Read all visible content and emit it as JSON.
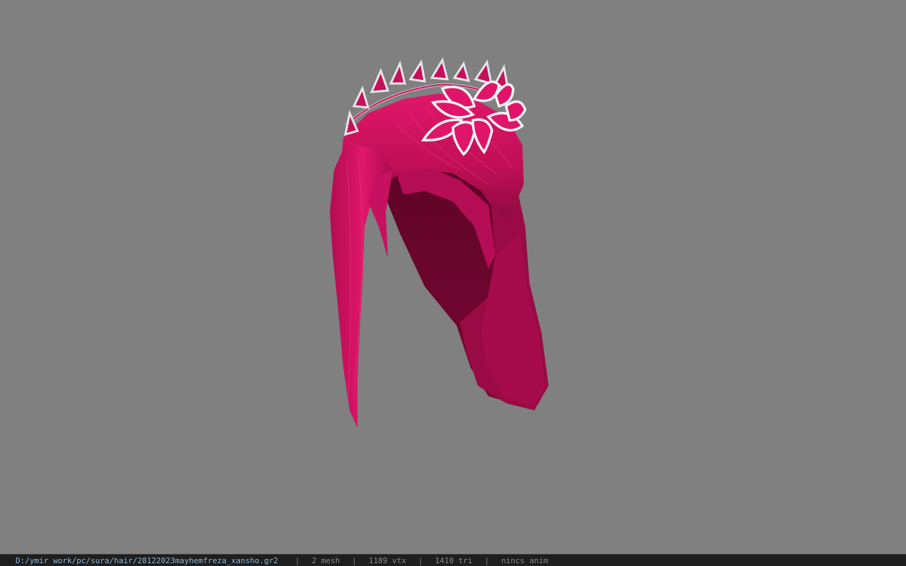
{
  "viewer": {
    "background": "#808080",
    "model": {
      "icon": "hair-with-leaf-tiara-model",
      "hair_color": "#d0115e",
      "accent_color": "#ffffff"
    }
  },
  "status": {
    "file_path": "D:/ymir work/pc/sura/hair/28122023mayhemfreza_xansho.gr2",
    "separator": "|",
    "mesh_count": "2 mesh",
    "vertex_count": "1189 vtx",
    "triangle_count": "1410 tri",
    "animation": "nincs anim"
  }
}
